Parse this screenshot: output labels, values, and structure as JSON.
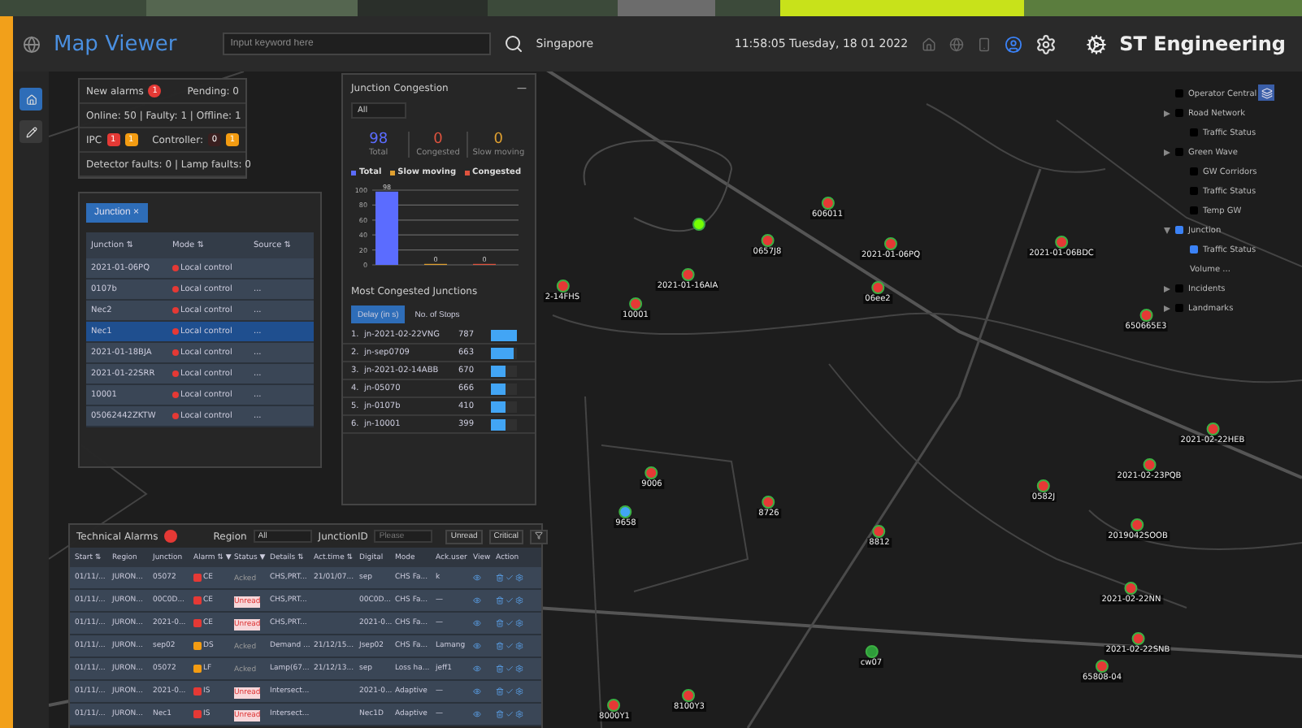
{
  "header": {
    "title": "Map Viewer",
    "search": {
      "placeholder": "Input keyword here"
    },
    "location": "Singapore",
    "datetime": "11:58:05 Tuesday, 18 01 2022",
    "brand": "ST Engineering"
  },
  "rail": [
    {
      "selected": true
    },
    {
      "selected": false
    }
  ],
  "status_panel": {
    "new_alarms": "New alarms",
    "new_alarms_badge": "1",
    "pending": "Pending: 0",
    "online": "Online: 50 | Faulty: 1 | Offline: 1",
    "ipc": "IPC",
    "ipc_badges": [
      {
        "text": "1",
        "color": "#e53935"
      },
      {
        "text": "1",
        "color": "#f39c12"
      }
    ],
    "controller": "Controller:",
    "controller_badges": [
      {
        "text": "0",
        "color": "#3a1f1f"
      },
      {
        "text": "1",
        "color": "#f39c12"
      }
    ],
    "faults": "Detector faults: 0 | Lamp faults: 0"
  },
  "junction_panel": {
    "filter": "Junction ×",
    "columns": [
      "Junction ⇅",
      "Mode ⇅",
      "Source ⇅"
    ],
    "rows": [
      {
        "junction": "2021-01-06PQ",
        "mode": "Local control",
        "selected": false
      },
      {
        "junction": "0107b",
        "mode": "Local control",
        "source": "...",
        "selected": false
      },
      {
        "junction": "Nec2",
        "mode": "Local control",
        "source": "...",
        "selected": false
      },
      {
        "junction": "Nec1",
        "mode": "Local control",
        "source": "...",
        "selected": true
      },
      {
        "junction": "2021-01-18BJA",
        "mode": "Local control",
        "source": "...",
        "selected": false
      },
      {
        "junction": "2021-01-22SRR",
        "mode": "Local control",
        "source": "...",
        "selected": false
      },
      {
        "junction": "10001",
        "mode": "Local control",
        "source": "...",
        "selected": false
      },
      {
        "junction": "05062442ZKTW",
        "mode": "Local control",
        "source": "...",
        "selected": false
      }
    ]
  },
  "congestion_panel": {
    "title": "Junction Congestion",
    "minimize": "—",
    "filter": "All",
    "stats": [
      {
        "value": "98",
        "label": "Total",
        "color": "#5b6cff"
      },
      {
        "value": "0",
        "label": "Congested",
        "color": "#e0533e"
      },
      {
        "value": "0",
        "label": "Slow moving",
        "color": "#e0a030"
      }
    ],
    "chart_data": {
      "type": "bar",
      "series": [
        {
          "name": "Total",
          "color": "#5b6cff",
          "values": [
            98
          ]
        },
        {
          "name": "Slow moving",
          "color": "#e0a030",
          "values": [
            0
          ]
        },
        {
          "name": "Congested",
          "color": "#e0533e",
          "values": [
            0
          ]
        }
      ],
      "ylim": [
        0,
        100
      ],
      "yticks": [
        0,
        20,
        40,
        60,
        80,
        100
      ],
      "data_labels": true,
      "grid": true
    },
    "most_title": "Most Congested Junctions",
    "tabs": [
      {
        "label": "Delay (in s)",
        "selected": true
      },
      {
        "label": "No. of Stops",
        "selected": false
      }
    ],
    "ranking": [
      {
        "rank": "1.",
        "name": "jn-2021-02-22VNG",
        "value": "787",
        "level": 1
      },
      {
        "rank": "2.",
        "name": "jn-sep0709",
        "value": "663",
        "level": 0.85
      },
      {
        "rank": "3.",
        "name": "jn-2021-02-14ABB",
        "value": "670",
        "level": 0.55
      },
      {
        "rank": "4.",
        "name": "jn-05070",
        "value": "666",
        "level": 0.55
      },
      {
        "rank": "5.",
        "name": "jn-0107b",
        "value": "410",
        "level": 0.55
      },
      {
        "rank": "6.",
        "name": "jn-10001",
        "value": "399",
        "level": 0.55
      }
    ]
  },
  "layers": [
    {
      "label": "Operator Central",
      "kind": "check",
      "checked": false
    },
    {
      "label": "Road Network",
      "kind": "check",
      "checked": false,
      "expanded": false,
      "children": [
        {
          "label": "Traffic Status",
          "kind": "check",
          "checked": false
        }
      ]
    },
    {
      "label": "Green Wave",
      "kind": "check",
      "checked": false,
      "expanded": false,
      "children": [
        {
          "label": "GW Corridors",
          "kind": "check",
          "checked": false
        },
        {
          "label": "Traffic Status",
          "kind": "check",
          "checked": false
        },
        {
          "label": "Temp GW",
          "kind": "check",
          "checked": false
        }
      ]
    },
    {
      "label": "Junction",
      "kind": "check",
      "checked": true,
      "expanded": true,
      "children": [
        {
          "label": "Traffic Status",
          "kind": "check",
          "checked": true
        },
        {
          "label": "Volume ...",
          "kind": "text"
        }
      ]
    },
    {
      "label": "Incidents",
      "kind": "check",
      "checked": false,
      "expanded": false
    },
    {
      "label": "Landmarks",
      "kind": "check",
      "checked": false,
      "expanded": false
    }
  ],
  "markers": [
    {
      "color": "#76ff03"
    },
    {
      "label": "0657J8",
      "color": "#e53935"
    },
    {
      "label": "606011",
      "color": "#e53935"
    },
    {
      "label": "2021-01-06PQ",
      "color": "#e53935"
    },
    {
      "label": "2021-01-06BDC",
      "color": "#e53935"
    },
    {
      "label": "06ee2",
      "color": "#e53935"
    },
    {
      "label": "2021-01-16AIA",
      "color": "#e53935"
    },
    {
      "label": "10001",
      "color": "#e53935"
    },
    {
      "label": "2-14FHS",
      "color": "#e53935"
    },
    {
      "label": "650665E3",
      "color": "#e53935"
    },
    {
      "label": "2021-02-22HEB",
      "color": "#e53935"
    },
    {
      "label": "2021-02-23PQB",
      "color": "#e53935"
    },
    {
      "label": "0582J",
      "color": "#e53935"
    },
    {
      "label": "2019042SOOB",
      "color": "#e53935"
    },
    {
      "label": "2021-02-22NN",
      "color": "#e53935"
    },
    {
      "label": "2021-02-22SNB",
      "color": "#e53935"
    },
    {
      "label": "9006",
      "color": "#e53935"
    },
    {
      "label": "9658",
      "color": "#42a5f5"
    },
    {
      "label": "8726",
      "color": "#e53935"
    },
    {
      "label": "8812",
      "color": "#e53935"
    },
    {
      "label": "cw07",
      "color": "#2e9d3a"
    },
    {
      "label": "8000Y1",
      "color": "#e53935"
    },
    {
      "label": "8100Y3",
      "color": "#e53935"
    },
    {
      "label": "65808-04",
      "color": "#e53935"
    }
  ],
  "alarms": {
    "title": "Technical Alarms",
    "region_label": "Region",
    "region_value": "All",
    "junction_label": "JunctionID",
    "junction_placeholder": "Please",
    "buttons": [
      "Unread",
      "Critical"
    ],
    "columns": [
      "Start ⇅",
      "Region",
      "Junction",
      "Alarm ⇅ ▼",
      "Status ▼",
      "Details ⇅",
      "Act.time ⇅",
      "Digital",
      "Mode",
      "Ack.user",
      "View",
      "Action"
    ],
    "rows": [
      {
        "start": "01/11/...",
        "region": "JURON...",
        "junction": "05072",
        "alarm": {
          "text": "CE",
          "color": "#e53935"
        },
        "status": {
          "kind": "acked",
          "text": "Acked"
        },
        "details": "CHS,PRT...",
        "act_time": "21/01/07...",
        "digital": "sep",
        "mode": "CHS Fa...",
        "user": "k"
      },
      {
        "start": "01/11/...",
        "region": "JURON...",
        "junction": "00C0D...",
        "alarm": {
          "text": "CE",
          "color": "#e53935"
        },
        "status": {
          "kind": "unread",
          "text": "Unread"
        },
        "details": "CHS,PRT...",
        "digital": "00C0D...",
        "mode": "CHS Fa...",
        "user": "—"
      },
      {
        "start": "01/11/...",
        "region": "JURON...",
        "junction": "2021-0...",
        "alarm": {
          "text": "CE",
          "color": "#e53935"
        },
        "status": {
          "kind": "unread",
          "text": "Unread"
        },
        "details": "CHS,PRT...",
        "digital": "2021-0...",
        "mode": "CHS Fa...",
        "user": "—"
      },
      {
        "start": "01/11/...",
        "region": "JURON...",
        "junction": "sep02",
        "alarm": {
          "text": "DS",
          "color": "#f39c12"
        },
        "status": {
          "kind": "acked",
          "text": "Acked"
        },
        "details": "Demand ...",
        "act_time": "21/12/15...",
        "digital": "Jsep02",
        "mode": "CHS Fa...",
        "user": "Lamang"
      },
      {
        "start": "01/11/...",
        "region": "JURON...",
        "junction": "05072",
        "alarm": {
          "text": "LF",
          "color": "#f39c12"
        },
        "status": {
          "kind": "acked",
          "text": "Acked"
        },
        "details": "Lamp(67...",
        "act_time": "21/12/13...",
        "digital": "sep",
        "mode": "Loss ha...",
        "user": "jeff1"
      },
      {
        "start": "01/11/...",
        "region": "JURON...",
        "junction": "2021-0...",
        "alarm": {
          "text": "IS",
          "color": "#e53935"
        },
        "status": {
          "kind": "unread",
          "text": "Unread"
        },
        "details": "Intersect...",
        "digital": "2021-0...",
        "mode": "Adaptive",
        "user": "—"
      },
      {
        "start": "01/11/...",
        "region": "JURON...",
        "junction": "Nec1",
        "alarm": {
          "text": "IS",
          "color": "#e53935"
        },
        "status": {
          "kind": "unread",
          "text": "Unread"
        },
        "details": "Intersect...",
        "digital": "Nec1D",
        "mode": "Adaptive",
        "user": "—"
      }
    ]
  }
}
